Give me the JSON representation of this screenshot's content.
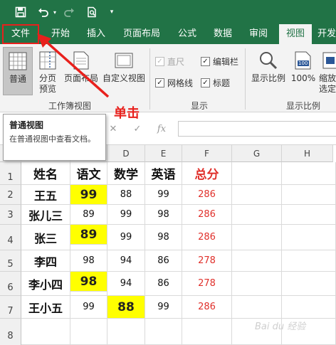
{
  "colors": {
    "excel_green": "#217346",
    "annotation_red": "#e8201c",
    "highlight_yellow": "#ffff00",
    "total_red": "#e0302b"
  },
  "qat": {
    "icons": [
      "save-icon",
      "undo-icon",
      "redo-icon",
      "print-preview-icon",
      "customize-qat-icon"
    ]
  },
  "tabs": [
    "文件",
    "开始",
    "插入",
    "页面布局",
    "公式",
    "数据",
    "审阅",
    "视图",
    "开发"
  ],
  "active_tab": "视图",
  "ribbon": {
    "workbook_views": {
      "label": "工作簿视图",
      "normal": "普通",
      "page_break": "分页\n预览",
      "page_layout": "页面布局",
      "custom": "自定义视图"
    },
    "show": {
      "label": "显示",
      "ruler": "直尺",
      "formula_bar": "编辑栏",
      "gridlines": "网格线",
      "headings": "标题"
    },
    "zoom": {
      "label": "显示比例",
      "zoom": "显示比例",
      "hundred": "100%",
      "hundred_icon_text": "100",
      "zoom_to_selection": "缩放\n选定"
    }
  },
  "tooltip": {
    "title": "普通视图",
    "body": "在普通视图中查看文档。"
  },
  "annotation": "单击",
  "formula_bar": {
    "fx_label": "fx"
  },
  "grid": {
    "columns": [
      "D",
      "E",
      "F",
      "G",
      "H"
    ],
    "rows": [
      "1",
      "2",
      "3",
      "4",
      "5",
      "6",
      "7",
      "8"
    ],
    "headers": {
      "name": "姓名",
      "chinese": "语文",
      "math": "数学",
      "english": "英语",
      "total": "总分"
    },
    "data": [
      {
        "name": "王五",
        "chinese": "99",
        "math": "88",
        "english": "99",
        "total": "286"
      },
      {
        "name": "张儿三",
        "chinese": "89",
        "math": "99",
        "english": "98",
        "total": "286"
      },
      {
        "name": "张三",
        "chinese": "89",
        "math": "99",
        "english": "98",
        "total": "286"
      },
      {
        "name": "李四",
        "chinese": "98",
        "math": "94",
        "english": "86",
        "total": "278"
      },
      {
        "name": "李小四",
        "chinese": "98",
        "math": "94",
        "english": "86",
        "total": "278"
      },
      {
        "name": "王小五",
        "chinese": "99",
        "math": "88",
        "english": "99",
        "total": "286"
      }
    ]
  },
  "watermark": "Bai du 经验"
}
